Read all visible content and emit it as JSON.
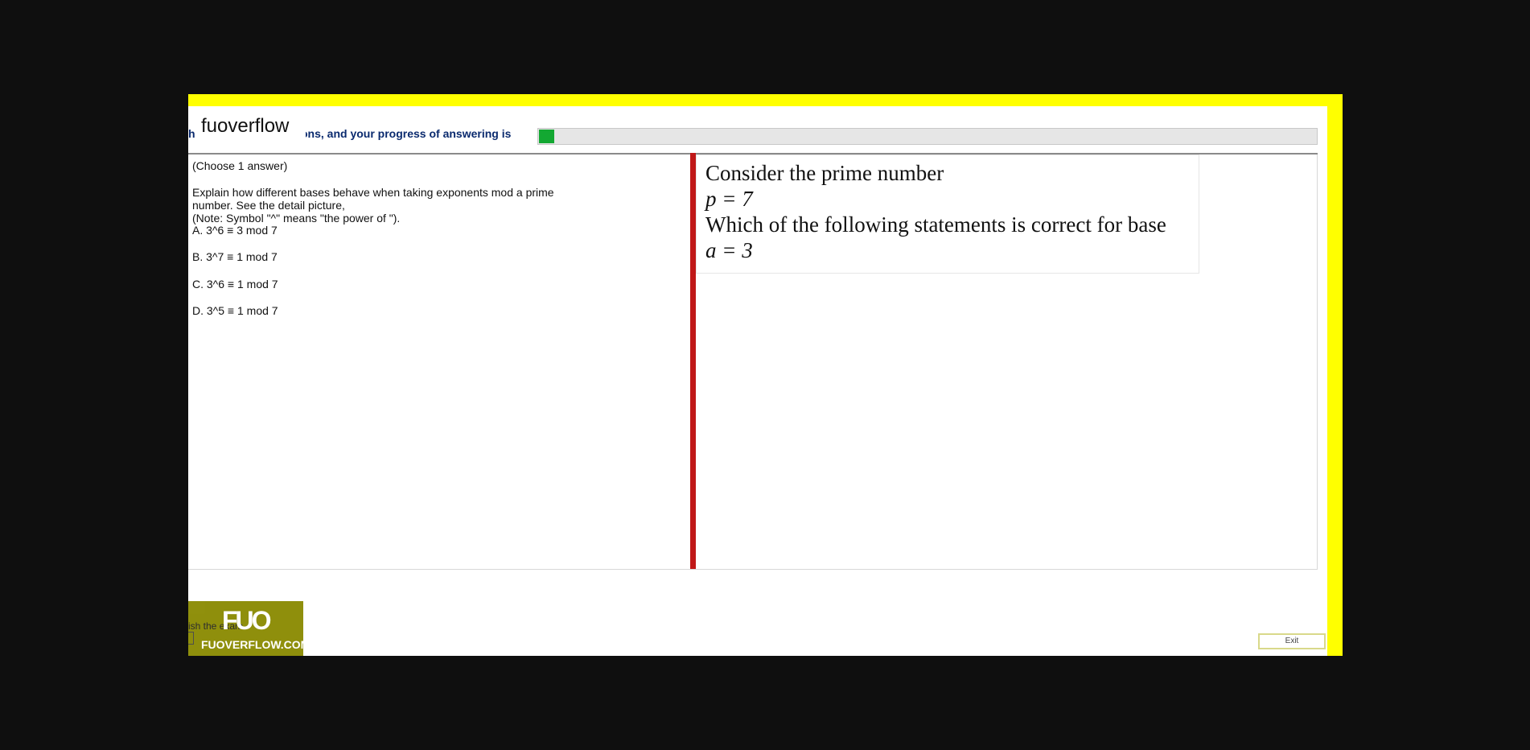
{
  "header": {
    "text_left": "h",
    "text_right": "ons, and your progress of answering is",
    "watermark": "fuoverflow",
    "progress_fraction": 0.02
  },
  "question": {
    "instruction": "(Choose 1 answer)",
    "lines": [
      "Explain how different bases behave when taking exponents mod a prime",
      "number. See the detail picture,",
      "(Note: Symbol \"^\" means \"the power of \")."
    ],
    "options": [
      {
        "text": "A.  3^6  ≡  3 mod 7"
      },
      {
        "text": "B.  3^7  ≡  1 mod 7"
      },
      {
        "text": "C.  3^6  ≡  1 mod 7"
      },
      {
        "text": "D.  3^5  ≡  1 mod 7"
      }
    ]
  },
  "content_image": {
    "lines": [
      "Consider the prime number",
      "p = 7",
      "Which of the following statements is correct for base",
      "a = 3"
    ]
  },
  "footer": {
    "finish_text": "ish the exam",
    "logo_mark": "FUO",
    "logo_site": "FUOVERFLOW.COM",
    "exit_label": "Exit"
  },
  "colors": {
    "background": "#0f0f0f",
    "app_yellow": "#ffff00",
    "progress_green": "#13a832",
    "splitter_red": "#c01818",
    "header_navy": "#0a2a6e"
  }
}
